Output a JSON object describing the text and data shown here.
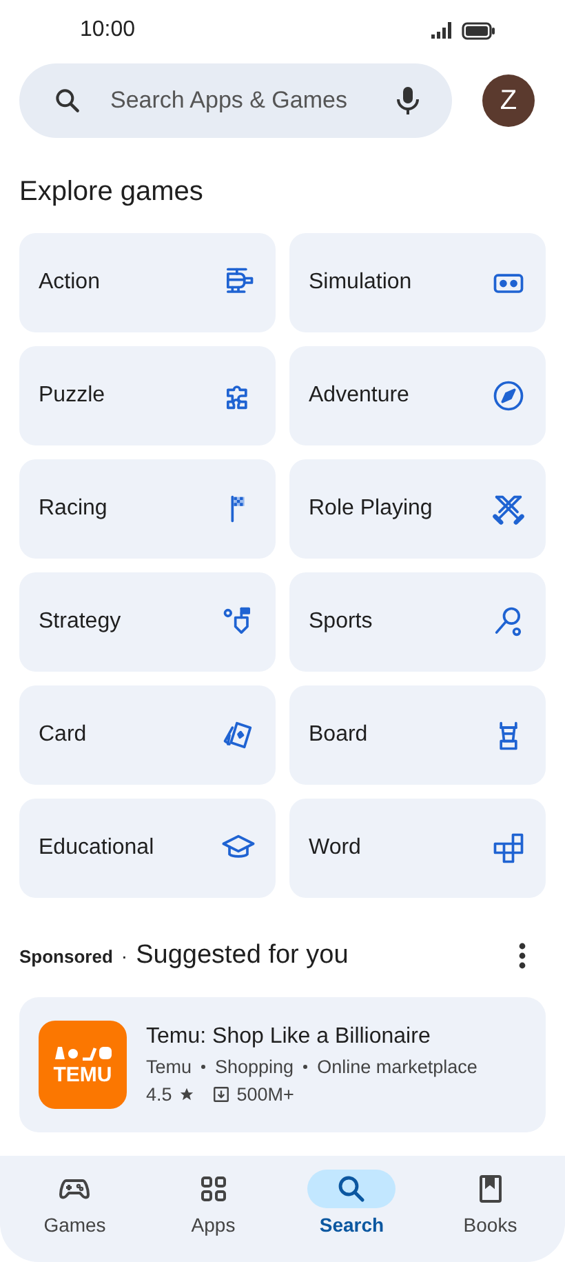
{
  "status_bar": {
    "time": "10:00"
  },
  "search": {
    "placeholder": "Search Apps & Games"
  },
  "avatar": {
    "initial": "Z"
  },
  "section_title": "Explore games",
  "categories": [
    {
      "label": "Action"
    },
    {
      "label": "Simulation"
    },
    {
      "label": "Puzzle"
    },
    {
      "label": "Adventure"
    },
    {
      "label": "Racing"
    },
    {
      "label": "Role Playing"
    },
    {
      "label": "Strategy"
    },
    {
      "label": "Sports"
    },
    {
      "label": "Card"
    },
    {
      "label": "Board"
    },
    {
      "label": "Educational"
    },
    {
      "label": "Word"
    }
  ],
  "suggested": {
    "sponsored": "Sponsored",
    "separator": "·",
    "title": "Suggested for you",
    "app": {
      "logo_text": "TEMU",
      "name": "Temu: Shop Like a Billionaire",
      "developer": "Temu",
      "category": "Shopping",
      "tag": "Online marketplace",
      "rating": "4.5",
      "downloads": "500M+"
    }
  },
  "nav": [
    {
      "label": "Games",
      "selected": false
    },
    {
      "label": "Apps",
      "selected": false
    },
    {
      "label": "Search",
      "selected": true
    },
    {
      "label": "Books",
      "selected": false
    }
  ]
}
